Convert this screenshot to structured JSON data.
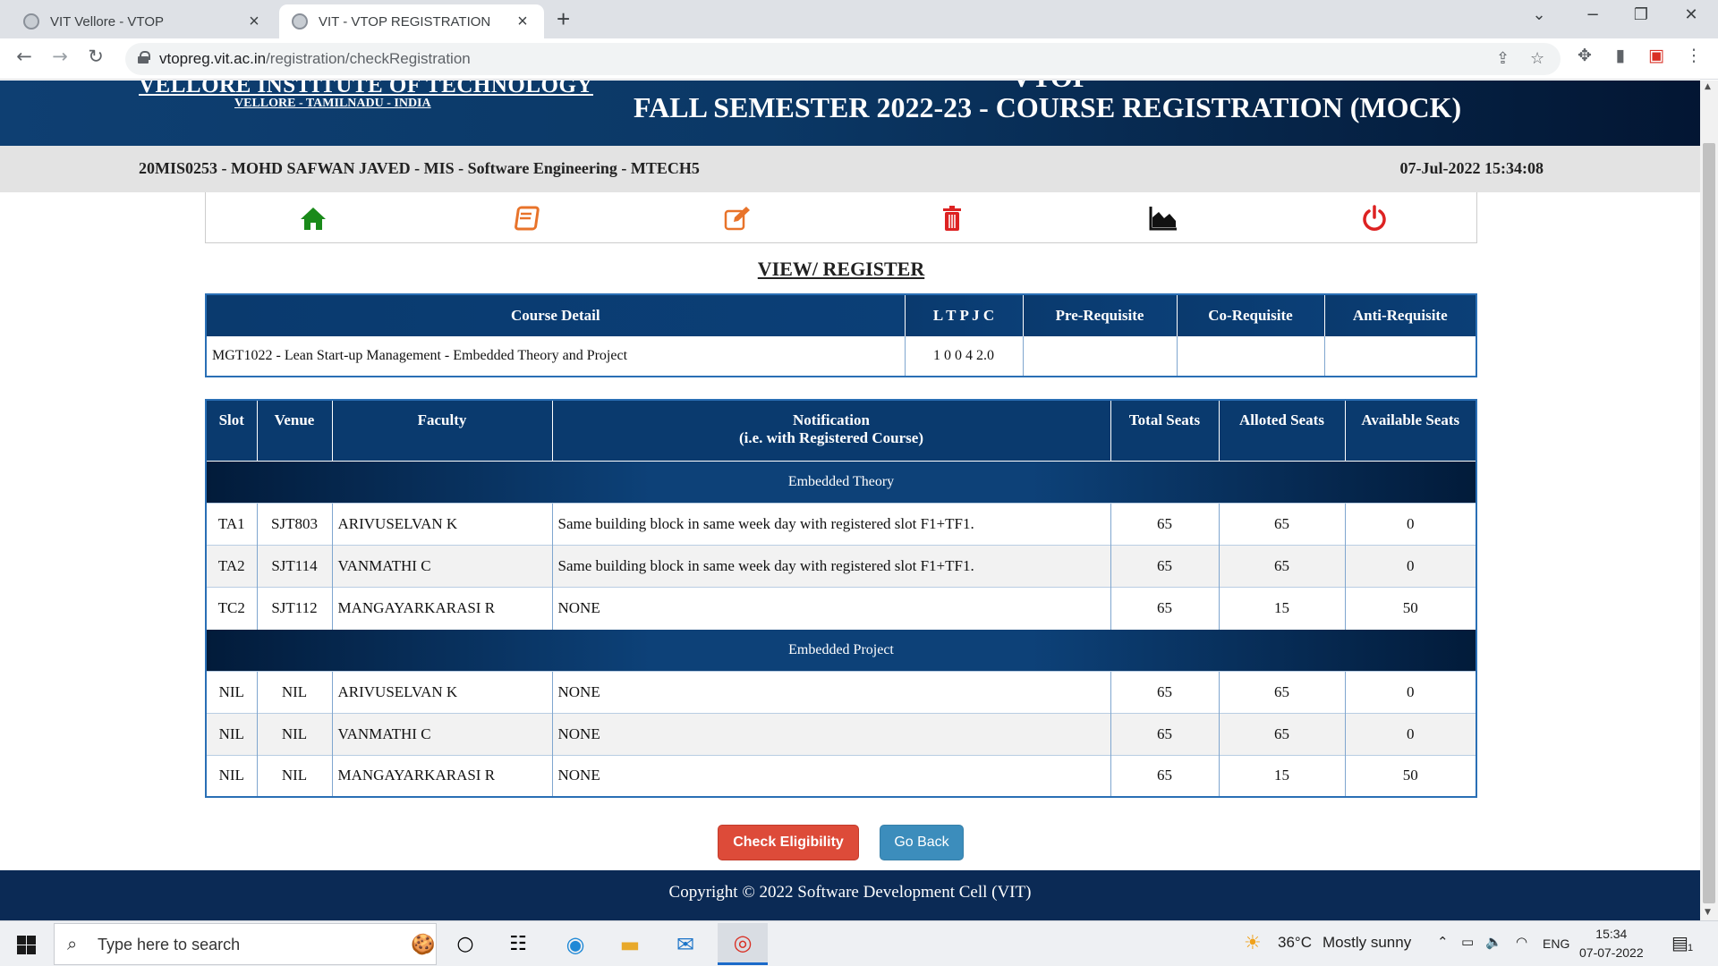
{
  "browser": {
    "tabs": [
      {
        "title": "VIT Vellore - VTOP",
        "active": false
      },
      {
        "title": "VIT - VTOP REGISTRATION",
        "active": true
      }
    ],
    "url_host": "vtopreg.vit.ac.in",
    "url_path": "/registration/checkRegistration",
    "new_tab": "+",
    "controls": {
      "minimize": "−",
      "maximize": "❐",
      "close": "✕",
      "tab_list": "⌄"
    }
  },
  "header": {
    "institute": "VELLORE INSTITUTE OF TECHNOLOGY",
    "location": "VELLORE - TAMILNADU - INDIA",
    "app": "VTOP",
    "semester_title": "FALL SEMESTER 2022-23 - COURSE REGISTRATION (MOCK)"
  },
  "student": {
    "info": "20MIS0253 - MOHD SAFWAN JAVED - MIS - Software Engineering - MTECH5",
    "datetime": "07-Jul-2022 15:34:08"
  },
  "menu_icons": [
    "home-icon",
    "book-icon",
    "edit-icon",
    "trash-icon",
    "chart-icon",
    "power-icon"
  ],
  "menu_colors": {
    "home": "#1a8a1a",
    "book": "#e8732a",
    "edit": "#e8732a",
    "trash": "#dd2222",
    "chart": "#111111",
    "power": "#dd2222"
  },
  "page_title": "VIEW/ REGISTER",
  "course_table": {
    "headers": [
      "Course Detail",
      "L T P J C",
      "Pre-Requisite",
      "Co-Requisite",
      "Anti-Requisite"
    ],
    "row": {
      "course": "MGT1022 - Lean Start-up Management - Embedded Theory and Project",
      "ltpjc": "1 0 0 4 2.0",
      "pre": "",
      "co": "",
      "anti": ""
    }
  },
  "slot_table": {
    "headers": {
      "slot": "Slot",
      "venue": "Venue",
      "faculty": "Faculty",
      "notification_line1": "Notification",
      "notification_line2": "(i.e. with Registered Course)",
      "total": "Total Seats",
      "alloted": "Alloted Seats",
      "available": "Available Seats"
    },
    "groups": [
      {
        "name": "Embedded Theory",
        "rows": [
          {
            "slot": "TA1",
            "venue": "SJT803",
            "faculty": "ARIVUSELVAN K",
            "note": "Same building block in same week day with registered slot F1+TF1.",
            "total": "65",
            "alloted": "65",
            "available": "0"
          },
          {
            "slot": "TA2",
            "venue": "SJT114",
            "faculty": "VANMATHI C",
            "note": "Same building block in same week day with registered slot F1+TF1.",
            "total": "65",
            "alloted": "65",
            "available": "0"
          },
          {
            "slot": "TC2",
            "venue": "SJT112",
            "faculty": "MANGAYARKARASI R",
            "note": "NONE",
            "total": "65",
            "alloted": "15",
            "available": "50"
          }
        ]
      },
      {
        "name": "Embedded Project",
        "rows": [
          {
            "slot": "NIL",
            "venue": "NIL",
            "faculty": "ARIVUSELVAN K",
            "note": "NONE",
            "total": "65",
            "alloted": "65",
            "available": "0"
          },
          {
            "slot": "NIL",
            "venue": "NIL",
            "faculty": "VANMATHI C",
            "note": "NONE",
            "total": "65",
            "alloted": "65",
            "available": "0"
          },
          {
            "slot": "NIL",
            "venue": "NIL",
            "faculty": "MANGAYARKARASI R",
            "note": "NONE",
            "total": "65",
            "alloted": "15",
            "available": "50"
          }
        ]
      }
    ]
  },
  "actions": {
    "check": "Check Eligibility",
    "back": "Go Back"
  },
  "footer": "Copyright © 2022 Software Development Cell (VIT)",
  "taskbar": {
    "search_placeholder": "Type here to search",
    "weather_temp": "36°C",
    "weather_text": "Mostly sunny",
    "language": "ENG",
    "time": "15:34",
    "date": "07-07-2022",
    "notification_count": "1"
  }
}
